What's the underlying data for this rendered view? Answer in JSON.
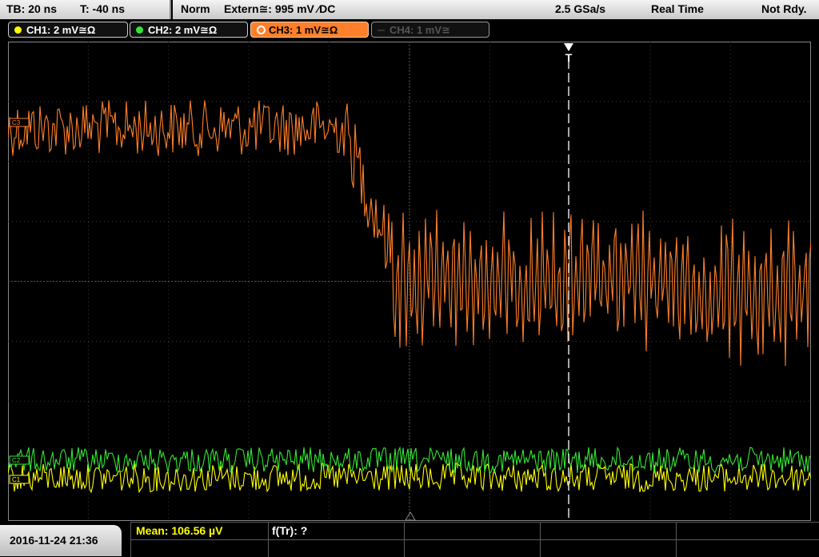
{
  "topbar": {
    "timebase": "TB: 20 ns",
    "trigger_time": "T: -40 ns",
    "mode": "Norm",
    "trigger_source": "Extern≅: 995 mV ⁄DC",
    "sample_rate": "2.5 GSa/s",
    "acq_mode": "Real Time",
    "ready_state": "Not Rdy."
  },
  "channels": [
    {
      "label": "CH1: 2 mV≅Ω",
      "color": "#ffff00",
      "active": true
    },
    {
      "label": "CH2: 2 mV≅Ω",
      "color": "#33e633",
      "active": true
    },
    {
      "label": "CH3: 1 mV≅Ω",
      "color": "#ff7f2a",
      "active": true,
      "selected": true
    },
    {
      "label": "CH4: 1 mV≅",
      "color": "#555555",
      "active": false
    }
  ],
  "markers": {
    "trigger_marker": "T",
    "ch3_marker": "C3",
    "ch2_marker": "C2",
    "ch1_marker": "C1"
  },
  "bottombar": {
    "datetime": "2016-11-24 21:36",
    "mean": "Mean: 106.56 µV",
    "ftr": "f(Tr): ?"
  },
  "colors": {
    "ch1": "#ffff00",
    "ch2": "#33e633",
    "ch3": "#ff7f2a",
    "grid": "#3a3a3a",
    "trigger_line": "#ffffff"
  }
}
